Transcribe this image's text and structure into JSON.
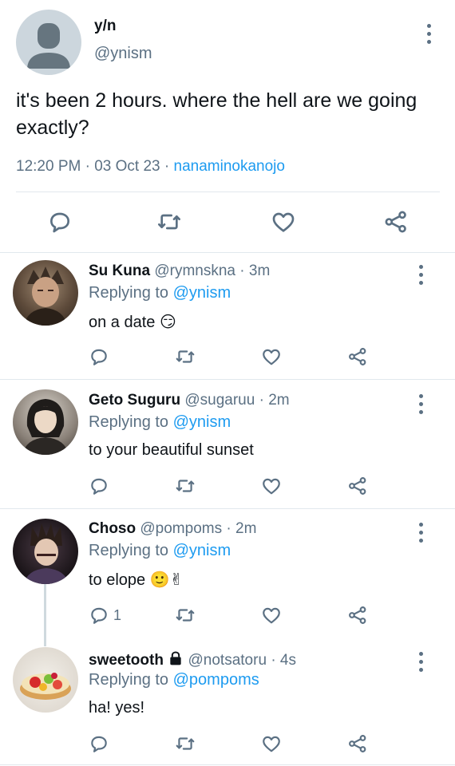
{
  "main_tweet": {
    "display_name": "y/n",
    "handle": "@ynism",
    "text": "it's been 2 hours. where the hell are we going exactly?",
    "time": "12:20 PM",
    "date": "03 Oct 23",
    "source": "nanaminokanojo",
    "icons": [
      "reply-icon",
      "retweet-icon",
      "like-icon",
      "share-icon"
    ]
  },
  "replies": [
    {
      "display_name": "Su Kuna",
      "handle": "@rymnskna",
      "time": "3m",
      "replying_label": "Replying to",
      "replying_handle": "@ynism",
      "text": "on a date",
      "emoji": "😏",
      "reply_count": ""
    },
    {
      "display_name": "Geto Suguru",
      "handle": "@sugaruu",
      "time": "2m",
      "replying_label": "Replying to",
      "replying_handle": "@ynism",
      "text": "to your beautiful sunset",
      "emoji": "",
      "reply_count": ""
    },
    {
      "display_name": "Choso",
      "handle": "@pompoms",
      "time": "2m",
      "replying_label": "Replying to",
      "replying_handle": "@ynism",
      "text": "to elope",
      "emoji": "🙂✌",
      "reply_count": "1"
    },
    {
      "display_name": "sweetooth",
      "handle": "@notsatoru",
      "time": "4s",
      "replying_label": "Replying to",
      "replying_handle": "@pompoms",
      "text": "ha! yes!",
      "emoji": "",
      "reply_count": "",
      "locked": true
    }
  ],
  "separator": "·",
  "colors": {
    "link": "#1d9bf0",
    "muted": "#5b7083",
    "divider": "#e1e8ed"
  }
}
